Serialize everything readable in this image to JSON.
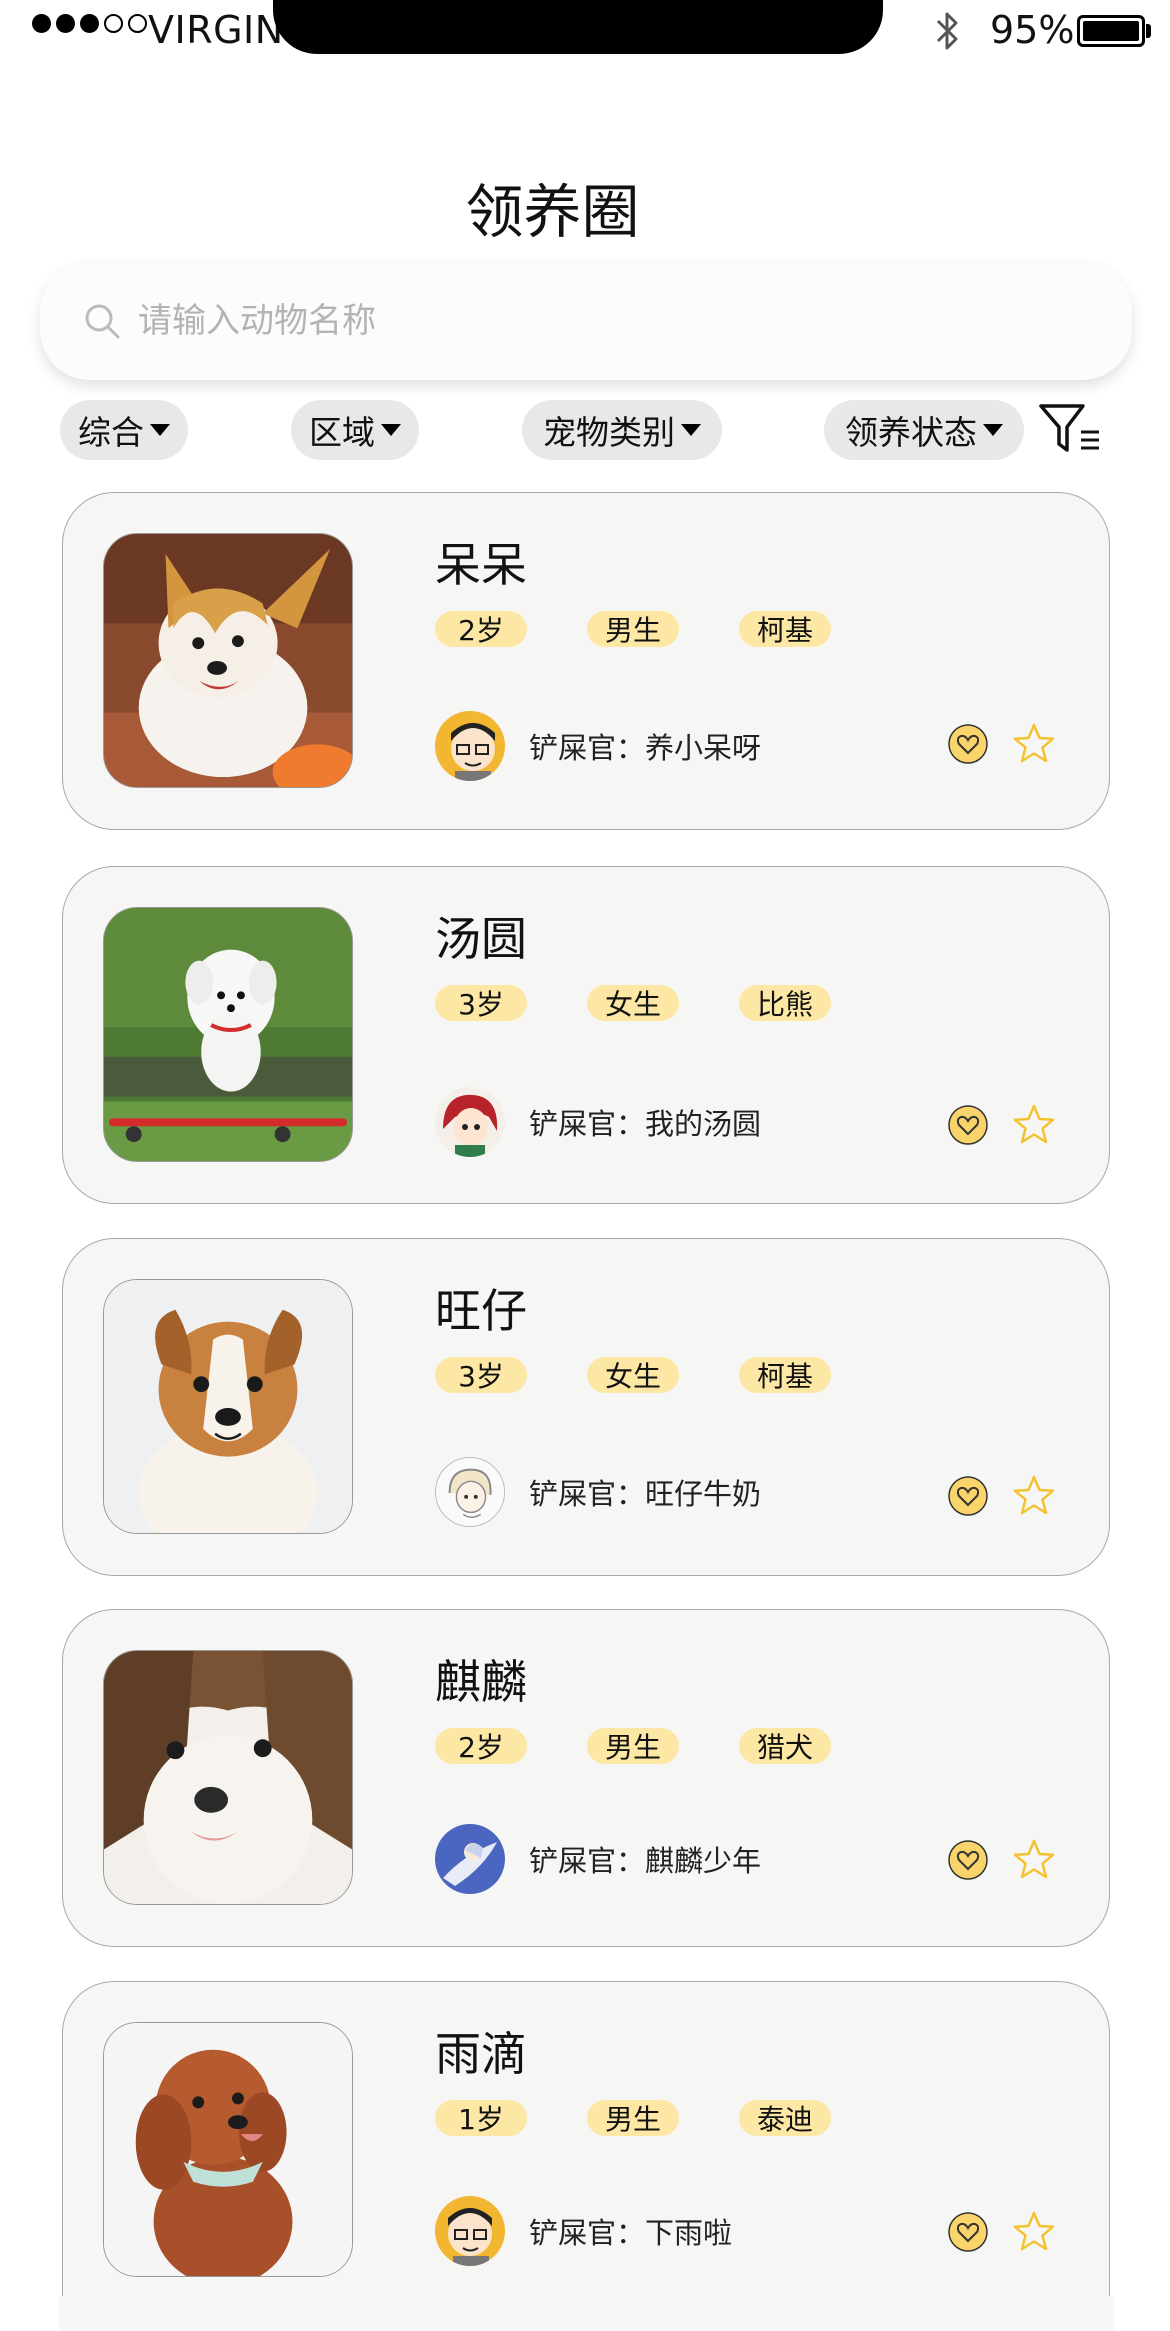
{
  "status_bar": {
    "carrier": "VIRGIN",
    "battery": "95%",
    "signal_bars": 3,
    "signal_total": 5
  },
  "header": {
    "title": "领养圈"
  },
  "search": {
    "placeholder": "请输入动物名称"
  },
  "filters": [
    {
      "label": "综合"
    },
    {
      "label": "区域"
    },
    {
      "label": "宠物类别"
    },
    {
      "label": "领养状态"
    }
  ],
  "owner_prefix": "铲屎官：",
  "pets": [
    {
      "name": "呆呆",
      "tags": [
        "2岁",
        "男生",
        "柯基"
      ],
      "owner": "养小呆呀",
      "photo": "corgi-adult-photo",
      "avatar": "glasses-boy-avatar"
    },
    {
      "name": "汤圆",
      "tags": [
        "3岁",
        "女生",
        "比熊"
      ],
      "owner": "我的汤圆",
      "photo": "white-puppy-skateboard-photo",
      "avatar": "red-hair-girl-avatar"
    },
    {
      "name": "旺仔",
      "tags": [
        "3岁",
        "女生",
        "柯基"
      ],
      "owner": "旺仔牛奶",
      "photo": "corgi-puppy-photo",
      "avatar": "sketch-girl-avatar"
    },
    {
      "name": "麒麟",
      "tags": [
        "2岁",
        "男生",
        "猎犬"
      ],
      "owner": "麒麟少年",
      "photo": "puppy-closeup-photo",
      "avatar": "blue-anime-avatar"
    },
    {
      "name": "雨滴",
      "tags": [
        "1岁",
        "男生",
        "泰迪"
      ],
      "owner": "下雨啦",
      "photo": "teddy-poodle-photo",
      "avatar": "glasses-boy-avatar"
    }
  ],
  "colors": {
    "tag_bg": "#fde7a4",
    "like_fill": "#f8d46b",
    "star_stroke": "#f5c22f",
    "card_bg": "#f6f6f5"
  }
}
